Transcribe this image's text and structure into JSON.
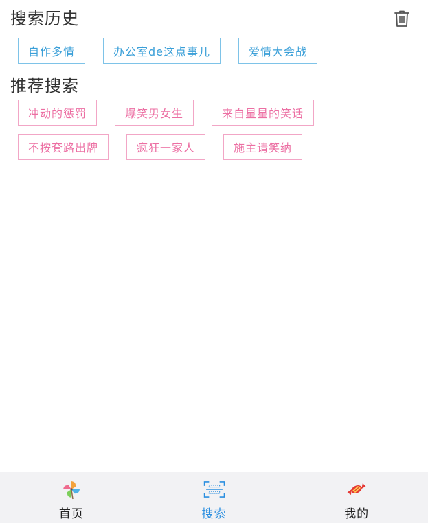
{
  "history": {
    "title": "搜索历史",
    "items": [
      "自作多情",
      "办公室de这点事儿",
      "爱情大会战"
    ]
  },
  "recommend": {
    "title": "推荐搜索",
    "items": [
      "冲动的惩罚",
      "爆笑男女生",
      "来自星星的笑话",
      "不按套路出牌",
      "疯狂一家人",
      "施主请笑纳"
    ]
  },
  "tabbar": {
    "tabs": [
      {
        "label": "首页",
        "icon": "pinwheel-icon",
        "active": false
      },
      {
        "label": "搜索",
        "icon": "scan-icon",
        "active": true
      },
      {
        "label": "我的",
        "icon": "candy-icon",
        "active": false
      }
    ]
  },
  "colors": {
    "history_border": "#7ec3e8",
    "history_text": "#3a9fd8",
    "recommend_border": "#f2a6c6",
    "recommend_text": "#ec6fa3",
    "active_tab": "#2b8fe0"
  }
}
